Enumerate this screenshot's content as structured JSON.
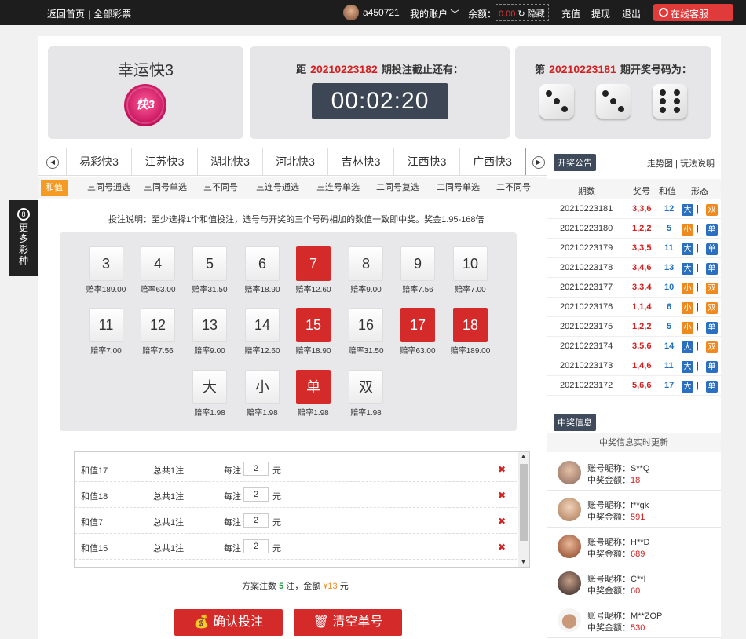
{
  "topbar": {
    "home": "返回首页",
    "all_lottery": "全部彩票",
    "username": "a450721",
    "my_account": "我的账户",
    "balance_label": "余额：",
    "balance": "0.00",
    "hide": "隐藏",
    "recharge": "充值",
    "withdraw": "提现",
    "logout": "退出",
    "service": "在线客服"
  },
  "game": {
    "name": "幸运快3",
    "logo_text": "快3"
  },
  "countdown": {
    "prefix": "距",
    "period": "20210223182",
    "suffix": "期投注截止还有：",
    "time": "00:02:20"
  },
  "result": {
    "prefix": "第",
    "period": "20210223181",
    "suffix": "期开奖号码为：",
    "dice": [
      3,
      3,
      6
    ]
  },
  "game_tabs": [
    "易彩快3",
    "江苏快3",
    "湖北快3",
    "河北快3",
    "吉林快3",
    "江西快3",
    "广西快3"
  ],
  "play_tabs": [
    "和值",
    "三同号通选",
    "三同号单选",
    "三不同号",
    "三连号通选",
    "三连号单选",
    "二同号复选",
    "二同号单选",
    "二不同号"
  ],
  "rules": "投注说明：至少选择1个和值投注，选号与开奖的三个号码相加的数值一致即中奖。奖金1.95-168倍",
  "balls": [
    {
      "label": "3",
      "odds": "赔率189.00",
      "selected": false
    },
    {
      "label": "4",
      "odds": "赔率63.00",
      "selected": false
    },
    {
      "label": "5",
      "odds": "赔率31.50",
      "selected": false
    },
    {
      "label": "6",
      "odds": "赔率18.90",
      "selected": false
    },
    {
      "label": "7",
      "odds": "赔率12.60",
      "selected": true
    },
    {
      "label": "8",
      "odds": "赔率9.00",
      "selected": false
    },
    {
      "label": "9",
      "odds": "赔率7.56",
      "selected": false
    },
    {
      "label": "10",
      "odds": "赔率7.00",
      "selected": false
    },
    {
      "label": "11",
      "odds": "赔率7.00",
      "selected": false
    },
    {
      "label": "12",
      "odds": "赔率7.56",
      "selected": false
    },
    {
      "label": "13",
      "odds": "赔率9.00",
      "selected": false
    },
    {
      "label": "14",
      "odds": "赔率12.60",
      "selected": false
    },
    {
      "label": "15",
      "odds": "赔率18.90",
      "selected": true
    },
    {
      "label": "16",
      "odds": "赔率31.50",
      "selected": false
    },
    {
      "label": "17",
      "odds": "赔率63.00",
      "selected": true
    },
    {
      "label": "18",
      "odds": "赔率189.00",
      "selected": true
    },
    {
      "label": "大",
      "odds": "赔率1.98",
      "selected": false
    },
    {
      "label": "小",
      "odds": "赔率1.98",
      "selected": false
    },
    {
      "label": "单",
      "odds": "赔率1.98",
      "selected": true
    },
    {
      "label": "双",
      "odds": "赔率1.98",
      "selected": false
    }
  ],
  "bets": [
    {
      "name": "和值17",
      "count": "总共1注",
      "per": "每注",
      "amount": "2",
      "unit": "元"
    },
    {
      "name": "和值18",
      "count": "总共1注",
      "per": "每注",
      "amount": "2",
      "unit": "元"
    },
    {
      "name": "和值7",
      "count": "总共1注",
      "per": "每注",
      "amount": "2",
      "unit": "元"
    },
    {
      "name": "和值15",
      "count": "总共1注",
      "per": "每注",
      "amount": "2",
      "unit": "元"
    }
  ],
  "summary": {
    "prefix": "方案注数",
    "count": "5",
    "mid": "注，金额",
    "amount": "¥13",
    "suffix": "元"
  },
  "buttons": {
    "confirm": "确认投注",
    "clear": "清空单号"
  },
  "side": {
    "label": "更多彩种",
    "icon": "8"
  },
  "right": {
    "notice": "开奖公告",
    "trend": "走势图",
    "howto": "玩法说明",
    "headers": [
      "期数",
      "奖号",
      "和值",
      "形态"
    ],
    "draws": [
      {
        "period": "20210223181",
        "nums": "3,3,6",
        "sum": "12",
        "size": "大",
        "parity": "双"
      },
      {
        "period": "20210223180",
        "nums": "1,2,2",
        "sum": "5",
        "size": "小",
        "parity": "单"
      },
      {
        "period": "20210223179",
        "nums": "3,3,5",
        "sum": "11",
        "size": "大",
        "parity": "单"
      },
      {
        "period": "20210223178",
        "nums": "3,4,6",
        "sum": "13",
        "size": "大",
        "parity": "单"
      },
      {
        "period": "20210223177",
        "nums": "3,3,4",
        "sum": "10",
        "size": "小",
        "parity": "双"
      },
      {
        "period": "20210223176",
        "nums": "1,1,4",
        "sum": "6",
        "size": "小",
        "parity": "双"
      },
      {
        "period": "20210223175",
        "nums": "1,2,2",
        "sum": "5",
        "size": "小",
        "parity": "单"
      },
      {
        "period": "20210223174",
        "nums": "3,5,6",
        "sum": "14",
        "size": "大",
        "parity": "双"
      },
      {
        "period": "20210223173",
        "nums": "1,4,6",
        "sum": "11",
        "size": "大",
        "parity": "单"
      },
      {
        "period": "20210223172",
        "nums": "5,6,6",
        "sum": "17",
        "size": "大",
        "parity": "单"
      }
    ],
    "win_title": "中奖信息",
    "win_sub": "中奖信息实时更新",
    "winners": [
      {
        "nick_label": "账号昵称：",
        "nick": "S**Q",
        "amt_label": "中奖金额：",
        "amount": "18",
        "color": "#8a6a5a"
      },
      {
        "nick_label": "账号昵称：",
        "nick": "f**gk",
        "amt_label": "中奖金额：",
        "amount": "591",
        "color": "#c9a080"
      },
      {
        "nick_label": "账号昵称：",
        "nick": "H**D",
        "amt_label": "中奖金额：",
        "amount": "689",
        "color": "#a86040"
      },
      {
        "nick_label": "账号昵称：",
        "nick": "C**I",
        "amt_label": "中奖金额：",
        "amount": "60",
        "color": "#3a3030"
      },
      {
        "nick_label": "账号昵称：",
        "nick": "M**ZOP",
        "amt_label": "中奖金额：",
        "amount": "530",
        "color": "#6a5040"
      }
    ]
  }
}
